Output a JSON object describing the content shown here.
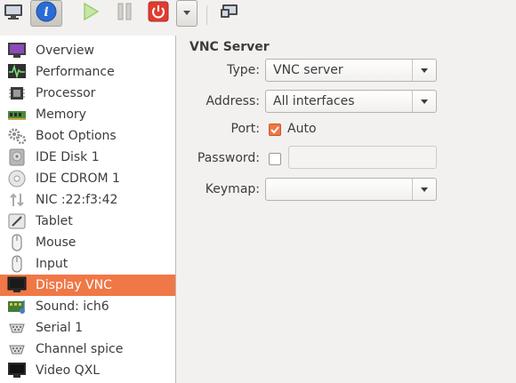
{
  "toolbar": {
    "buttons": [
      {
        "icon": "monitor-icon"
      },
      {
        "icon": "info-icon",
        "label": "i"
      },
      {
        "icon": "play-icon"
      },
      {
        "icon": "pause-icon"
      },
      {
        "icon": "power-icon"
      },
      {
        "icon": "chevron-down-icon"
      },
      {
        "icon": "screenshot-icon"
      }
    ]
  },
  "sidebar": {
    "items": [
      {
        "label": "Overview",
        "icon": "overview-icon"
      },
      {
        "label": "Performance",
        "icon": "performance-icon"
      },
      {
        "label": "Processor",
        "icon": "processor-icon"
      },
      {
        "label": "Memory",
        "icon": "memory-icon"
      },
      {
        "label": "Boot Options",
        "icon": "gear-icon"
      },
      {
        "label": "IDE Disk 1",
        "icon": "disk-icon"
      },
      {
        "label": "IDE CDROM 1",
        "icon": "cdrom-icon"
      },
      {
        "label": "NIC :22:f3:42",
        "icon": "network-icon"
      },
      {
        "label": "Tablet",
        "icon": "tablet-icon"
      },
      {
        "label": "Mouse",
        "icon": "mouse-icon"
      },
      {
        "label": "Input",
        "icon": "input-icon"
      },
      {
        "label": "Display VNC",
        "icon": "display-icon",
        "selected": true
      },
      {
        "label": "Sound: ich6",
        "icon": "sound-icon"
      },
      {
        "label": "Serial 1",
        "icon": "serial-icon"
      },
      {
        "label": "Channel spice",
        "icon": "channel-icon"
      },
      {
        "label": "Video QXL",
        "icon": "video-icon"
      }
    ]
  },
  "vnc": {
    "title": "VNC Server",
    "type_label": "Type:",
    "type_value": "VNC server",
    "address_label": "Address:",
    "address_value": "All interfaces",
    "port_label": "Port:",
    "port_auto_label": "Auto",
    "port_auto_checked": true,
    "password_label": "Password:",
    "password_checked": false,
    "password_value": "",
    "keymap_label": "Keymap:",
    "keymap_value": ""
  },
  "colors": {
    "accent": "#f07746",
    "info_blue": "#2a6bd6",
    "play_green": "#9bcf6a",
    "power_red": "#e03c31"
  }
}
